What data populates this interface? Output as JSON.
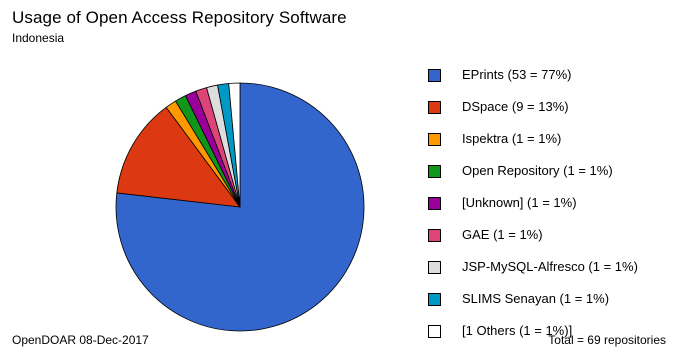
{
  "chart_data": {
    "type": "pie",
    "title": "Usage of Open Access Repository Software",
    "subtitle": "Indonesia",
    "start_angle_deg": 0,
    "direction": "clockwise",
    "slices": [
      {
        "label": "EPrints",
        "value": 53,
        "legend": "EPrints (53 = 77%)",
        "color": "#3366cc"
      },
      {
        "label": "DSpace",
        "value": 9,
        "legend": "DSpace (9 = 13%)",
        "color": "#dc3912"
      },
      {
        "label": "Ispektra",
        "value": 1,
        "legend": "Ispektra (1 = 1%)",
        "color": "#ff9900"
      },
      {
        "label": "Open Repository",
        "value": 1,
        "legend": "Open Repository (1 = 1%)",
        "color": "#109618"
      },
      {
        "label": "[Unknown]",
        "value": 1,
        "legend": "[Unknown] (1 = 1%)",
        "color": "#990099"
      },
      {
        "label": "GAE",
        "value": 1,
        "legend": "GAE (1 = 1%)",
        "color": "#dd4477"
      },
      {
        "label": "JSP-MySQL-Alfresco",
        "value": 1,
        "legend": "JSP-MySQL-Alfresco (1 = 1%)",
        "color": "#dddddd"
      },
      {
        "label": "SLIMS Senayan",
        "value": 1,
        "legend": "SLIMS Senayan (1 = 1%)",
        "color": "#0099c6"
      },
      {
        "label": "[1 Others",
        "value": 1,
        "legend": "[1 Others (1 = 1%)]",
        "color": "#ffffff"
      }
    ],
    "legend_position": "right"
  },
  "footer": {
    "source": "OpenDOAR 08-Dec-2017",
    "total": "Total = 69 repositories"
  }
}
